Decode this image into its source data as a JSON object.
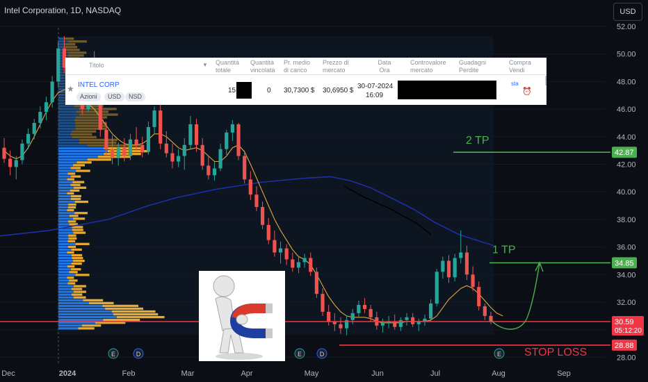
{
  "header": {
    "title": "Intel Corporation, 1D, NASDAQ",
    "currency": "USD"
  },
  "chart_data": {
    "type": "candlestick",
    "ylim": [
      27.5,
      53
    ],
    "y_ticks": [
      "52.00",
      "50.00",
      "48.00",
      "46.00",
      "44.00",
      "42.00",
      "40.00",
      "38.00",
      "36.00",
      "34.00",
      "32.00",
      "30.00",
      "28.00"
    ],
    "x_ticks": [
      "Dec",
      "2024",
      "Feb",
      "Mar",
      "Apr",
      "May",
      "Jun",
      "Jul",
      "Aug",
      "Sep"
    ],
    "candles": [
      {
        "o": 43.2,
        "h": 43.9,
        "l": 42.1,
        "c": 42.4
      },
      {
        "o": 42.4,
        "h": 43.0,
        "l": 41.2,
        "c": 41.8
      },
      {
        "o": 41.8,
        "h": 42.6,
        "l": 40.9,
        "c": 42.3
      },
      {
        "o": 42.3,
        "h": 43.8,
        "l": 42.0,
        "c": 43.5
      },
      {
        "o": 43.5,
        "h": 44.6,
        "l": 43.1,
        "c": 44.2
      },
      {
        "o": 44.2,
        "h": 45.3,
        "l": 43.8,
        "c": 45.0
      },
      {
        "o": 45.0,
        "h": 46.2,
        "l": 44.6,
        "c": 45.8
      },
      {
        "o": 45.8,
        "h": 46.9,
        "l": 45.2,
        "c": 46.5
      },
      {
        "o": 46.5,
        "h": 48.4,
        "l": 46.1,
        "c": 48.0
      },
      {
        "o": 48.0,
        "h": 50.9,
        "l": 47.6,
        "c": 50.4
      },
      {
        "o": 50.4,
        "h": 51.3,
        "l": 48.6,
        "c": 49.0
      },
      {
        "o": 49.0,
        "h": 49.6,
        "l": 47.0,
        "c": 47.4
      },
      {
        "o": 47.4,
        "h": 48.2,
        "l": 46.3,
        "c": 46.7
      },
      {
        "o": 46.7,
        "h": 47.5,
        "l": 45.6,
        "c": 46.0
      },
      {
        "o": 46.0,
        "h": 49.1,
        "l": 45.8,
        "c": 48.8
      },
      {
        "o": 48.8,
        "h": 50.2,
        "l": 47.4,
        "c": 47.7
      },
      {
        "o": 47.7,
        "h": 48.1,
        "l": 44.0,
        "c": 44.5
      },
      {
        "o": 44.5,
        "h": 45.0,
        "l": 42.6,
        "c": 43.1
      },
      {
        "o": 43.1,
        "h": 44.1,
        "l": 42.0,
        "c": 42.5
      },
      {
        "o": 42.5,
        "h": 43.6,
        "l": 41.9,
        "c": 43.2
      },
      {
        "o": 43.2,
        "h": 43.9,
        "l": 42.2,
        "c": 42.6
      },
      {
        "o": 42.6,
        "h": 44.2,
        "l": 42.3,
        "c": 43.8
      },
      {
        "o": 43.8,
        "h": 44.7,
        "l": 43.0,
        "c": 43.4
      },
      {
        "o": 43.4,
        "h": 44.0,
        "l": 42.5,
        "c": 42.9
      },
      {
        "o": 42.9,
        "h": 45.1,
        "l": 42.7,
        "c": 44.7
      },
      {
        "o": 44.7,
        "h": 46.2,
        "l": 44.2,
        "c": 45.9
      },
      {
        "o": 45.9,
        "h": 46.5,
        "l": 43.1,
        "c": 43.5
      },
      {
        "o": 43.5,
        "h": 44.4,
        "l": 42.5,
        "c": 42.8
      },
      {
        "o": 42.8,
        "h": 43.5,
        "l": 41.7,
        "c": 42.2
      },
      {
        "o": 42.2,
        "h": 43.1,
        "l": 41.8,
        "c": 42.6
      },
      {
        "o": 42.6,
        "h": 43.9,
        "l": 41.6,
        "c": 43.4
      },
      {
        "o": 43.4,
        "h": 45.5,
        "l": 43.1,
        "c": 44.9
      },
      {
        "o": 44.9,
        "h": 45.3,
        "l": 42.9,
        "c": 43.4
      },
      {
        "o": 43.4,
        "h": 43.9,
        "l": 41.6,
        "c": 41.9
      },
      {
        "o": 41.9,
        "h": 42.6,
        "l": 40.9,
        "c": 41.2
      },
      {
        "o": 41.2,
        "h": 42.2,
        "l": 40.8,
        "c": 41.7
      },
      {
        "o": 41.7,
        "h": 43.5,
        "l": 41.5,
        "c": 43.1
      },
      {
        "o": 43.1,
        "h": 44.5,
        "l": 42.7,
        "c": 44.3
      },
      {
        "o": 44.3,
        "h": 45.2,
        "l": 43.7,
        "c": 44.9
      },
      {
        "o": 44.9,
        "h": 45.0,
        "l": 42.3,
        "c": 42.6
      },
      {
        "o": 42.6,
        "h": 43.0,
        "l": 40.6,
        "c": 40.9
      },
      {
        "o": 40.9,
        "h": 41.5,
        "l": 39.4,
        "c": 39.8
      },
      {
        "o": 39.8,
        "h": 40.4,
        "l": 38.6,
        "c": 38.9
      },
      {
        "o": 38.9,
        "h": 39.3,
        "l": 37.3,
        "c": 37.6
      },
      {
        "o": 37.6,
        "h": 38.1,
        "l": 36.2,
        "c": 36.5
      },
      {
        "o": 36.5,
        "h": 37.2,
        "l": 35.3,
        "c": 35.6
      },
      {
        "o": 35.6,
        "h": 36.4,
        "l": 34.8,
        "c": 35.9
      },
      {
        "o": 35.9,
        "h": 36.2,
        "l": 34.7,
        "c": 35.1
      },
      {
        "o": 35.1,
        "h": 35.6,
        "l": 34.2,
        "c": 34.5
      },
      {
        "o": 34.5,
        "h": 35.3,
        "l": 34.1,
        "c": 34.9
      },
      {
        "o": 34.9,
        "h": 35.5,
        "l": 34.5,
        "c": 35.2
      },
      {
        "o": 35.2,
        "h": 35.6,
        "l": 33.9,
        "c": 34.2
      },
      {
        "o": 34.2,
        "h": 34.5,
        "l": 32.3,
        "c": 32.6
      },
      {
        "o": 32.6,
        "h": 33.0,
        "l": 31.0,
        "c": 31.3
      },
      {
        "o": 31.3,
        "h": 31.8,
        "l": 30.3,
        "c": 30.6
      },
      {
        "o": 30.6,
        "h": 31.2,
        "l": 29.9,
        "c": 30.4
      },
      {
        "o": 30.4,
        "h": 30.9,
        "l": 29.7,
        "c": 30.1
      },
      {
        "o": 30.1,
        "h": 31.0,
        "l": 29.6,
        "c": 30.7
      },
      {
        "o": 30.7,
        "h": 31.5,
        "l": 30.4,
        "c": 31.2
      },
      {
        "o": 31.2,
        "h": 32.1,
        "l": 30.9,
        "c": 31.8
      },
      {
        "o": 31.8,
        "h": 32.3,
        "l": 31.2,
        "c": 31.5
      },
      {
        "o": 31.5,
        "h": 31.8,
        "l": 30.6,
        "c": 30.9
      },
      {
        "o": 30.9,
        "h": 31.3,
        "l": 30.0,
        "c": 30.3
      },
      {
        "o": 30.3,
        "h": 30.8,
        "l": 29.8,
        "c": 30.5
      },
      {
        "o": 30.5,
        "h": 31.0,
        "l": 30.1,
        "c": 30.6
      },
      {
        "o": 30.6,
        "h": 31.1,
        "l": 30.0,
        "c": 30.2
      },
      {
        "o": 30.2,
        "h": 30.9,
        "l": 29.9,
        "c": 30.7
      },
      {
        "o": 30.7,
        "h": 31.2,
        "l": 30.3,
        "c": 30.9
      },
      {
        "o": 30.9,
        "h": 31.2,
        "l": 30.2,
        "c": 30.4
      },
      {
        "o": 30.4,
        "h": 30.8,
        "l": 29.9,
        "c": 30.6
      },
      {
        "o": 30.6,
        "h": 31.1,
        "l": 30.3,
        "c": 30.8
      },
      {
        "o": 30.8,
        "h": 32.2,
        "l": 30.6,
        "c": 31.9
      },
      {
        "o": 31.9,
        "h": 34.4,
        "l": 31.7,
        "c": 34.2
      },
      {
        "o": 34.2,
        "h": 35.3,
        "l": 33.7,
        "c": 35.0
      },
      {
        "o": 35.0,
        "h": 35.4,
        "l": 33.4,
        "c": 33.8
      },
      {
        "o": 33.8,
        "h": 35.5,
        "l": 33.5,
        "c": 35.2
      },
      {
        "o": 35.2,
        "h": 37.2,
        "l": 34.8,
        "c": 35.6
      },
      {
        "o": 35.6,
        "h": 36.1,
        "l": 33.6,
        "c": 34.0
      },
      {
        "o": 34.0,
        "h": 34.6,
        "l": 32.8,
        "c": 33.1
      },
      {
        "o": 33.1,
        "h": 33.5,
        "l": 31.4,
        "c": 31.7
      },
      {
        "o": 31.7,
        "h": 31.9,
        "l": 30.7,
        "c": 31.0
      },
      {
        "o": 31.0,
        "h": 31.3,
        "l": 30.4,
        "c": 30.59
      }
    ],
    "ma_short": [
      43.0,
      42.6,
      42.4,
      42.6,
      43.2,
      44.0,
      44.9,
      45.8,
      46.6,
      47.2,
      47.4,
      47.3,
      47.0,
      46.6,
      46.4,
      46.0,
      45.4,
      44.8,
      44.2,
      43.8,
      43.5,
      43.4,
      43.4,
      43.5,
      43.8,
      44.2,
      44.2,
      44.0,
      43.6,
      43.2,
      43.0,
      43.1,
      43.2,
      43.0,
      42.6,
      42.2,
      42.2,
      42.6,
      43.2,
      43.4,
      42.9,
      42.0,
      41.0,
      40.0,
      39.0,
      38.0,
      37.2,
      36.5,
      35.8,
      35.3,
      35.1,
      34.7,
      34.0,
      33.2,
      32.4,
      31.8,
      31.3,
      31.0,
      30.9,
      30.9,
      30.9,
      30.8,
      30.6,
      30.5,
      30.5,
      30.5,
      30.5,
      30.6,
      30.6,
      30.6,
      30.6,
      30.7,
      31.0,
      31.6,
      32.2,
      32.6,
      33.0,
      33.2,
      33.0,
      32.6,
      32.1,
      31.6,
      31.2,
      31.0
    ],
    "ma_long_points": [
      [
        0,
        36.8
      ],
      [
        0.1,
        37.2
      ],
      [
        0.22,
        38.0
      ],
      [
        0.3,
        39.0
      ],
      [
        0.36,
        39.6
      ],
      [
        0.44,
        40.2
      ],
      [
        0.53,
        40.7
      ],
      [
        0.62,
        41.0
      ],
      [
        0.67,
        41.1
      ],
      [
        0.71,
        40.8
      ],
      [
        0.75,
        40.3
      ],
      [
        0.79,
        39.6
      ],
      [
        0.84,
        38.7
      ],
      [
        0.88,
        37.8
      ],
      [
        0.93,
        36.9
      ],
      [
        1.0,
        36.1
      ]
    ],
    "levels": [
      {
        "label": "2 TP",
        "value": 42.87,
        "price_label": "42.87",
        "color": "#4caf50"
      },
      {
        "label": "1 TP",
        "value": 34.85,
        "price_label": "34.85",
        "color": "#4caf50"
      },
      {
        "label": "STOP LOSS",
        "value": 28.88,
        "price_label": "28.88",
        "color": "#f23645"
      }
    ],
    "last_price": {
      "value": 30.59,
      "label": "30.59",
      "countdown": "05:12:20",
      "color": "#f23645"
    },
    "events": [
      "E",
      "D",
      "E",
      "D",
      "E"
    ]
  },
  "panel": {
    "headers": [
      "Titolo",
      "Quantità totale",
      "Quantità vincolata",
      "Pr. medio di carico",
      "Prezzo di mercato",
      "Data Ora",
      "Controvalore mercato",
      "Guadagni Perdite",
      "Compra Vendi"
    ],
    "row": {
      "name": "INTEL CORP",
      "qty_total": "15",
      "qty_bound": "0",
      "avg_price": "30,7300 $",
      "market_price": "30,6950 $",
      "date": "30-07-2024",
      "time": "16:09"
    },
    "chips": [
      "Azioni",
      "USD",
      "NSD"
    ],
    "partial_text": "sta"
  }
}
